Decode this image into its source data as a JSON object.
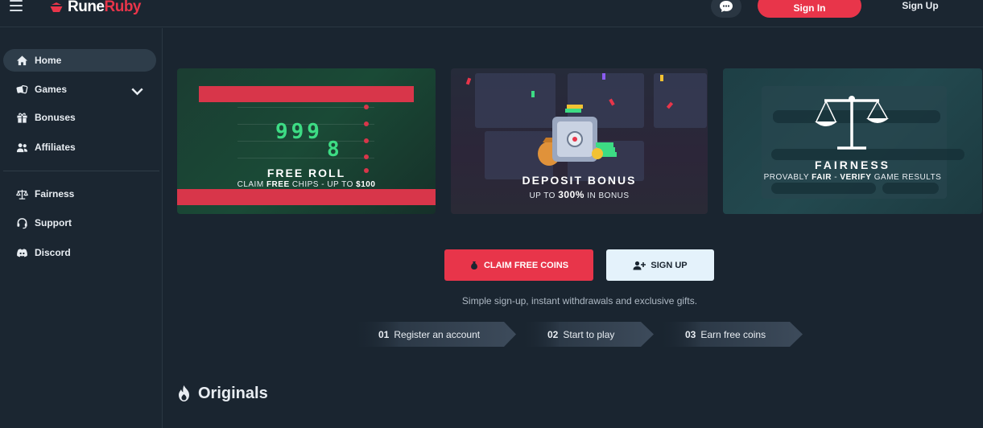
{
  "brand": {
    "name_part1": "Rune",
    "name_part2": "Ruby",
    "accent": "#e8354a"
  },
  "header": {
    "menu_icon": "hamburger-icon",
    "chat_icon": "chat-bubble-icon",
    "signin_label": "Sign In",
    "signup_label": "Sign Up"
  },
  "sidebar": {
    "items": [
      {
        "label": "Home",
        "icon": "home-icon",
        "active": true
      },
      {
        "label": "Games",
        "icon": "games-icon",
        "has_chevron": true
      },
      {
        "label": "Bonuses",
        "icon": "gift-icon"
      },
      {
        "label": "Affiliates",
        "icon": "users-icon"
      },
      {
        "label": "Fairness",
        "icon": "scales-icon"
      },
      {
        "label": "Support",
        "icon": "headset-icon"
      },
      {
        "label": "Discord",
        "icon": "discord-icon"
      }
    ]
  },
  "banners": [
    {
      "title": "FREE ROLL",
      "sub_pre": "CLAIM ",
      "sub_bold": "FREE",
      "sub_mid": " CHIPS - UP TO ",
      "sub_bold2": "$100",
      "digits": "999",
      "digit_last": "8"
    },
    {
      "title": "DEPOSIT BONUS",
      "sub_pre": "UP TO ",
      "sub_bold": "300%",
      "sub_mid": " IN BONUS"
    },
    {
      "title": "FAIRNESS",
      "sub_pre": "PROVABLY ",
      "sub_bold": "FAIR",
      "sub_mid": " - ",
      "sub_bold2": "VERIFY",
      "sub_post": " GAME RESULTS"
    }
  ],
  "cta": {
    "claim_label": "CLAIM FREE COINS",
    "claim_icon": "money-bag-icon",
    "signup_label": "SIGN UP",
    "signup_icon": "user-plus-icon",
    "tagline": "Simple sign-up, instant withdrawals and exclusive gifts."
  },
  "steps": [
    {
      "num": "01",
      "label": "Register an account"
    },
    {
      "num": "02",
      "label": "Start to play"
    },
    {
      "num": "03",
      "label": "Earn free coins"
    }
  ],
  "originals": {
    "title": "Originals",
    "icon": "flame-icon"
  }
}
